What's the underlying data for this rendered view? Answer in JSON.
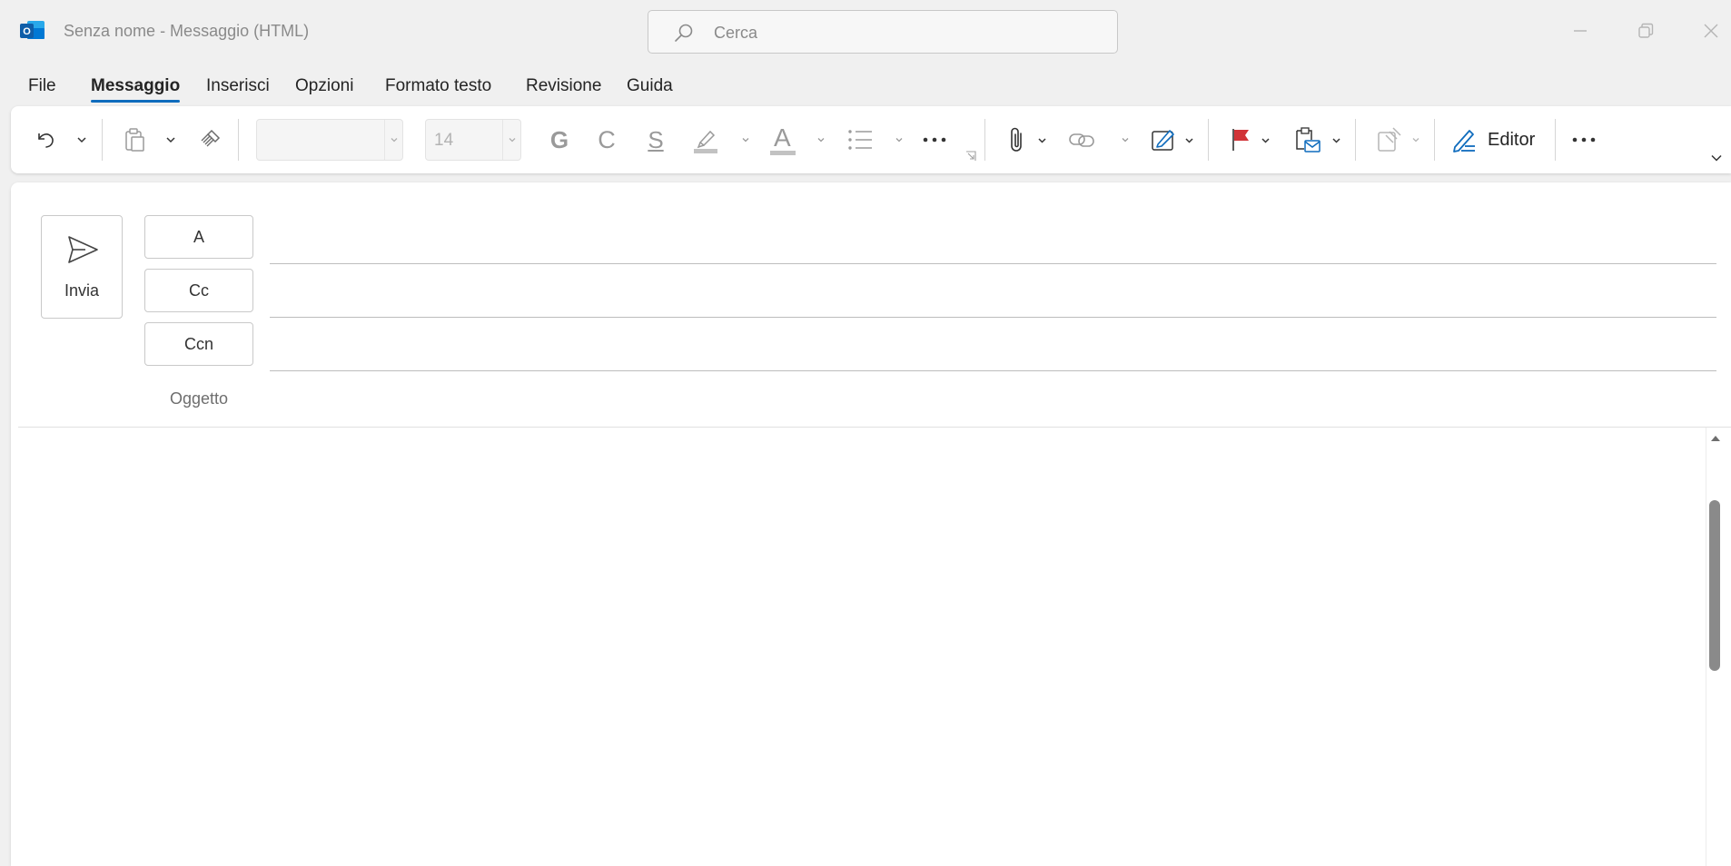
{
  "window": {
    "title": "Senza nome  -  Messaggio (HTML)",
    "app_icon": "outlook-icon",
    "controls": [
      "minimize-icon",
      "restore-icon",
      "close-icon"
    ]
  },
  "search": {
    "placeholder": "Cerca",
    "icon": "search-icon"
  },
  "tabs": [
    {
      "label": "File",
      "active": false
    },
    {
      "label": "Messaggio",
      "active": true
    },
    {
      "label": "Inserisci",
      "active": false
    },
    {
      "label": "Opzioni",
      "active": false
    },
    {
      "label": "Formato testo",
      "active": false
    },
    {
      "label": "Revisione",
      "active": false
    },
    {
      "label": "Guida",
      "active": false
    }
  ],
  "ribbon": {
    "font_name": "",
    "font_size": "14",
    "bold_glyph": "G",
    "italic_glyph": "C",
    "underline_glyph": "S",
    "font_color_glyph": "A",
    "editor_label": "Editor",
    "accent_color": "#0f6cbd",
    "flag_color": "#d13438"
  },
  "compose": {
    "send_label": "Invia",
    "to_label": "A",
    "cc_label": "Cc",
    "bcc_label": "Ccn",
    "subject_label": "Oggetto",
    "to_value": "",
    "cc_value": "",
    "bcc_value": "",
    "subject_value": "",
    "body": ""
  }
}
